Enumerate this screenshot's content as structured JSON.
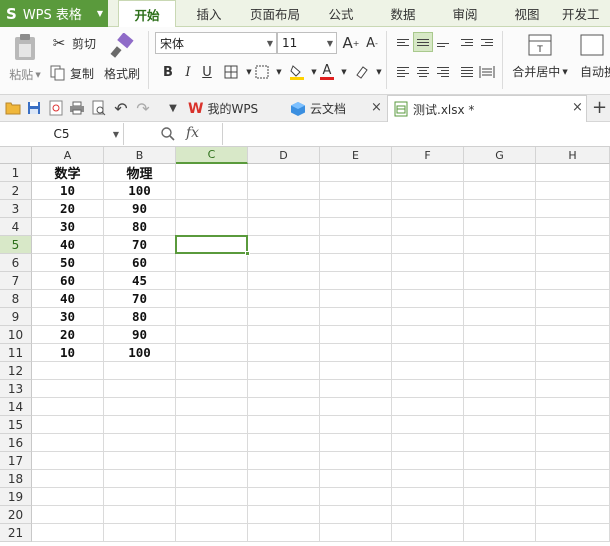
{
  "app": {
    "name": "WPS 表格",
    "logo": "S"
  },
  "menu_tabs": [
    "开始",
    "插入",
    "页面布局",
    "公式",
    "数据",
    "审阅",
    "视图",
    "开发工"
  ],
  "ribbon": {
    "paste": "粘贴",
    "cut": "剪切",
    "copy": "复制",
    "format_painter": "格式刷",
    "font_name": "宋体",
    "font_size": "11",
    "merge_center": "合并居中",
    "auto_wrap": "自动换"
  },
  "doc_tabs": {
    "my_wps": "我的WPS",
    "cloud_docs": "云文档",
    "current_file": "测试.xlsx *"
  },
  "formula_bar": {
    "cell_ref": "C5",
    "fx": "fx",
    "content": ""
  },
  "grid": {
    "columns": [
      "A",
      "B",
      "C",
      "D",
      "E",
      "F",
      "G",
      "H"
    ],
    "selected_column": "C",
    "selected_row": 5,
    "rows": [
      "1",
      "2",
      "3",
      "4",
      "5",
      "6",
      "7",
      "8",
      "9",
      "10",
      "11",
      "12",
      "13",
      "14",
      "15",
      "16",
      "17",
      "18",
      "19",
      "20",
      "21"
    ],
    "headers": [
      "数学",
      "物理"
    ],
    "data": [
      [
        "10",
        "100"
      ],
      [
        "20",
        "90"
      ],
      [
        "30",
        "80"
      ],
      [
        "40",
        "70"
      ],
      [
        "50",
        "60"
      ],
      [
        "60",
        "45"
      ],
      [
        "40",
        "70"
      ],
      [
        "30",
        "80"
      ],
      [
        "20",
        "90"
      ],
      [
        "10",
        "100"
      ]
    ]
  },
  "colors": {
    "accent": "#5a9a3c",
    "font_color_bar": "#e02020",
    "fill_color_bar": "#ffd200"
  }
}
